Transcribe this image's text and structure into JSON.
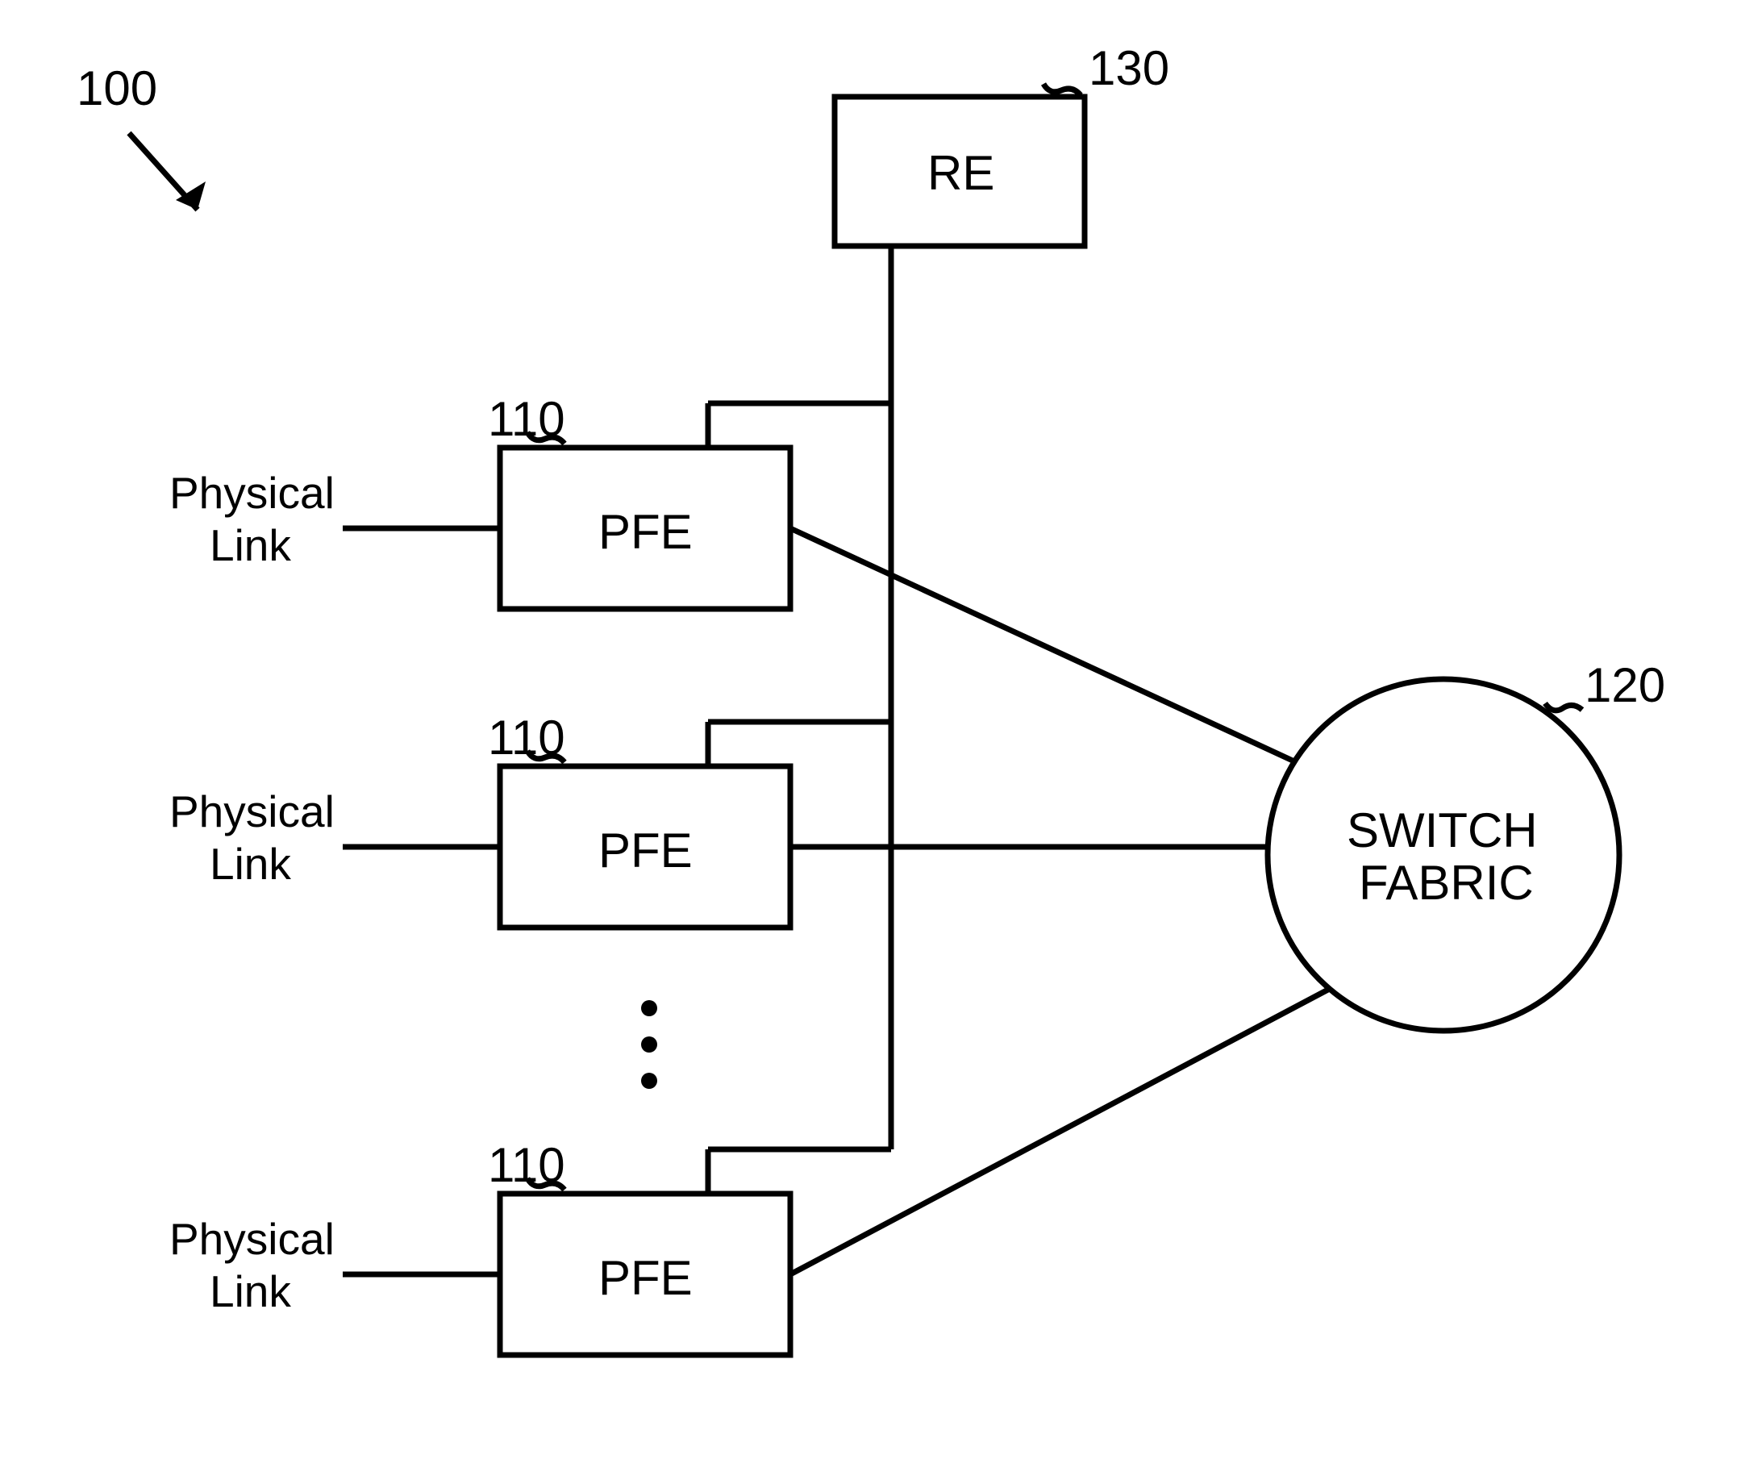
{
  "diagramRef": "100",
  "re": {
    "ref": "130",
    "label": "RE"
  },
  "pfes": [
    {
      "ref": "110",
      "label": "PFE",
      "linkLabel1": "Physical",
      "linkLabel2": "Link"
    },
    {
      "ref": "110",
      "label": "PFE",
      "linkLabel1": "Physical",
      "linkLabel2": "Link"
    },
    {
      "ref": "110",
      "label": "PFE",
      "linkLabel1": "Physical",
      "linkLabel2": "Link"
    }
  ],
  "switchFabric": {
    "ref": "120",
    "label1": "SWITCH",
    "label2": "FABRIC"
  }
}
